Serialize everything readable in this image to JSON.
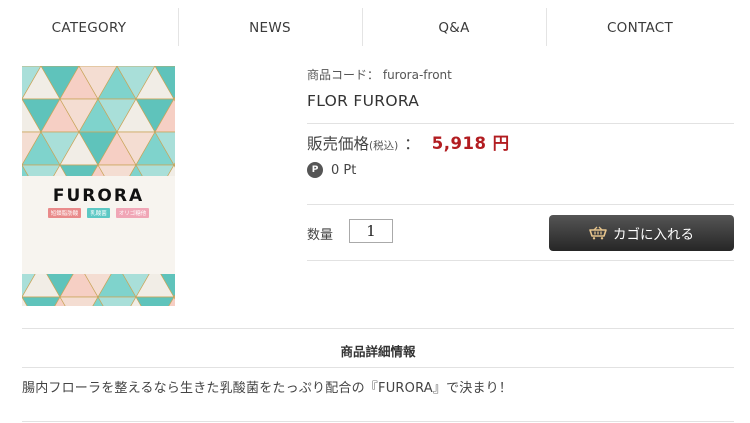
{
  "nav": {
    "items": [
      {
        "label": "CATEGORY"
      },
      {
        "label": "NEWS"
      },
      {
        "label": "Q&A"
      },
      {
        "label": "CONTACT"
      }
    ]
  },
  "product": {
    "image": {
      "brand": "FURORA",
      "badges": [
        "短鎖脂肪酸",
        "乳酸菌",
        "オリゴ糖他"
      ]
    },
    "code_label": "商品コード：",
    "code_value": "furora-front",
    "name": "FLOR FURORA",
    "price_label": "販売価格",
    "price_tax_note": "(税込)",
    "price_colon": "：",
    "price_value": "5,918 円",
    "price_color": "#b21d21",
    "points_icon": "P",
    "points_text": "0 Pt",
    "quantity_label": "数量",
    "quantity_value": "1",
    "cart_button_label": "カゴに入れる",
    "cart_icon": "cart-icon"
  },
  "details": {
    "heading": "商品詳細情報",
    "text": "腸内フローラを整えるなら生きた乳酸菌をたっぷり配合の『FURORA』で決まり！"
  }
}
